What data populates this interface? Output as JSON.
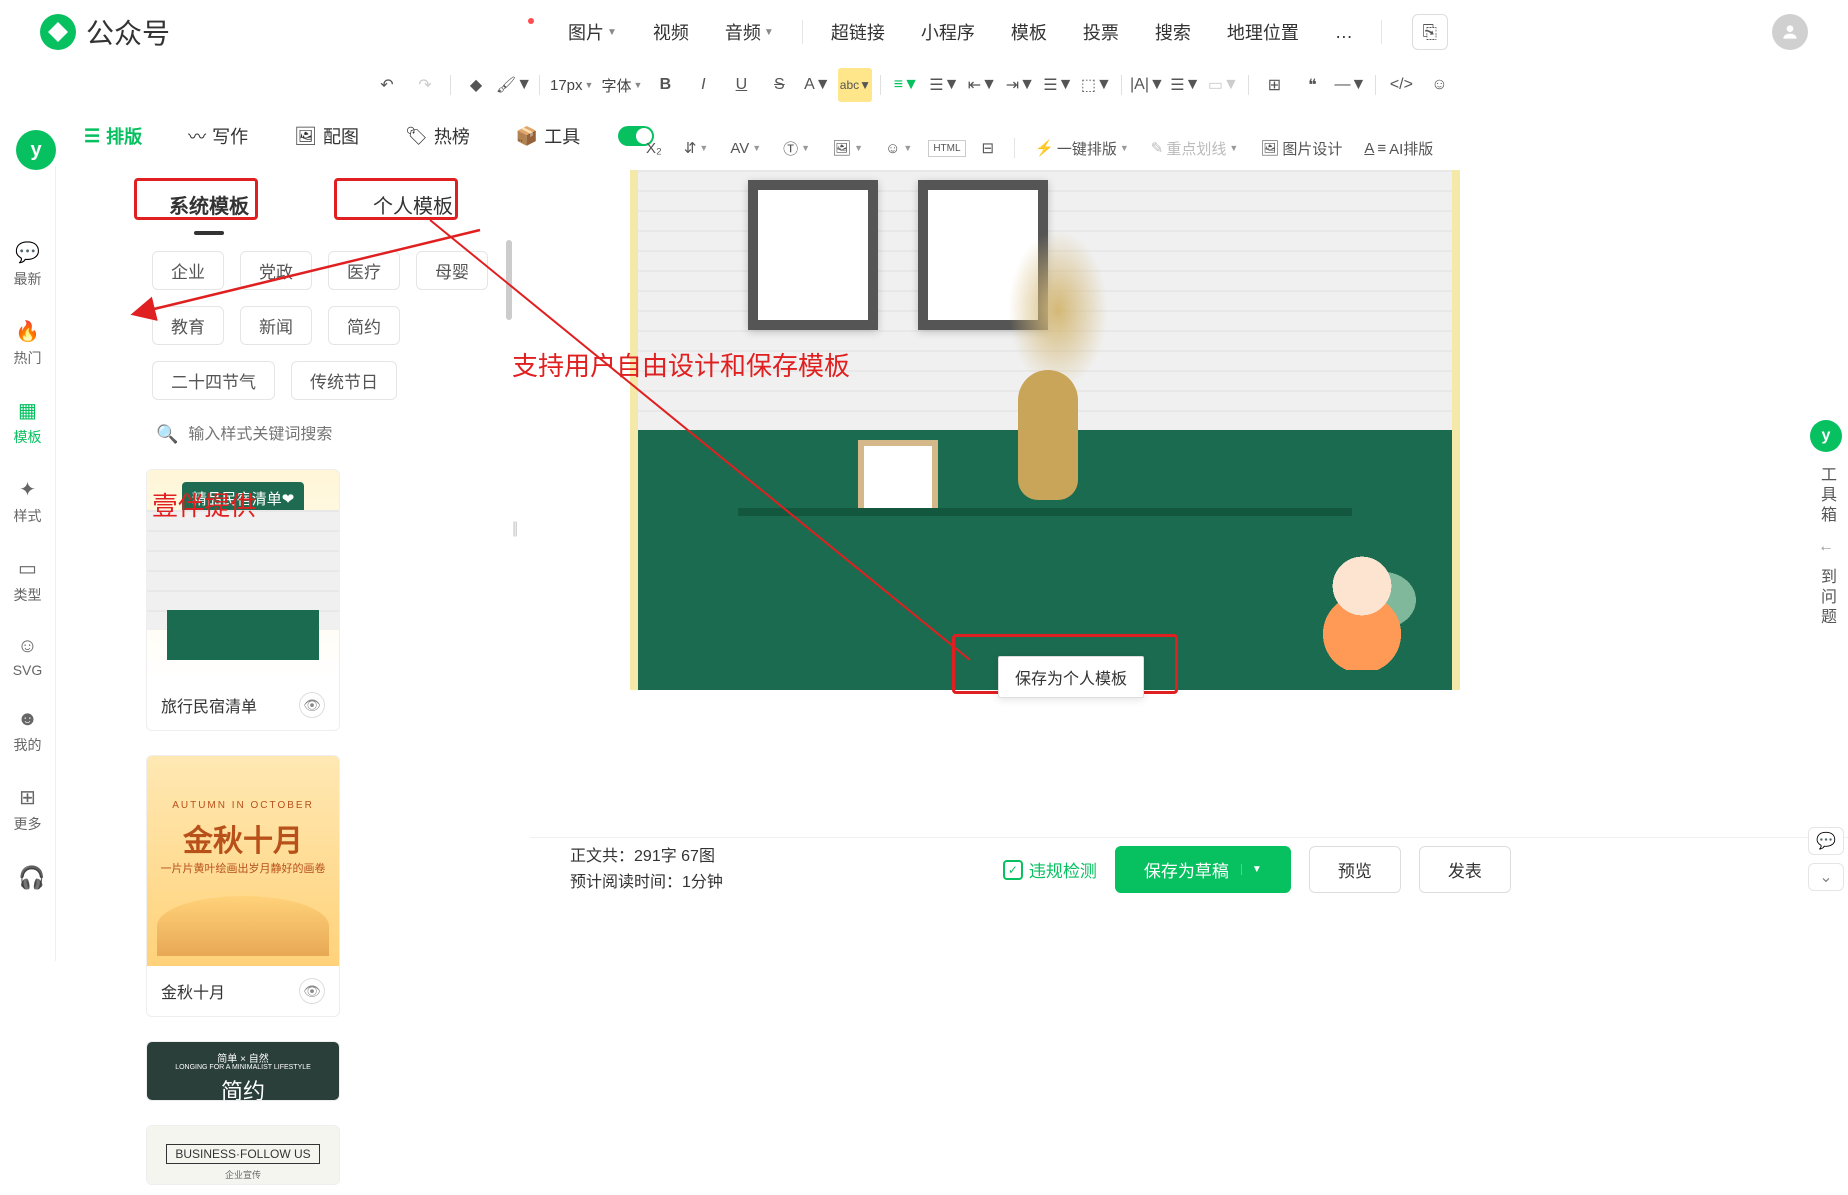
{
  "header": {
    "app_name": "公众号",
    "menu": {
      "image": "图片",
      "video": "视频",
      "audio": "音频",
      "link": "超链接",
      "miniprogram": "小程序",
      "template": "模板",
      "vote": "投票",
      "search": "搜索",
      "location": "地理位置",
      "more": "…"
    }
  },
  "toolbar1": {
    "font_size": "17px",
    "font_family": "字体"
  },
  "toolbar2": {
    "auto_layout": "一键排版",
    "highlight": "重点划线",
    "image_design": "图片设计",
    "ai_layout": "AI排版"
  },
  "tabs": {
    "layout": "排版",
    "write": "写作",
    "image": "配图",
    "hot": "热榜",
    "tools": "工具"
  },
  "left_rail": [
    {
      "icon": "💬",
      "label": "最新"
    },
    {
      "icon": "🔥",
      "label": "热门"
    },
    {
      "icon": "▦",
      "label": "模板",
      "active": true
    },
    {
      "icon": "✦",
      "label": "样式"
    },
    {
      "icon": "▭",
      "label": "类型"
    },
    {
      "icon": "☺",
      "label": "SVG"
    },
    {
      "icon": "☻",
      "label": "我的"
    },
    {
      "icon": "⊞",
      "label": "更多"
    }
  ],
  "template_tabs": {
    "system": "系统模板",
    "personal": "个人模板"
  },
  "categories": [
    "企业",
    "党政",
    "医疗",
    "母婴",
    "教育",
    "新闻",
    "简约",
    "二十四节气",
    "传统节日"
  ],
  "search": {
    "placeholder": "输入样式关键词搜索"
  },
  "annotations": {
    "provider": "壹伴提供",
    "support": "支持用户自由设计和保存模板"
  },
  "templates": [
    {
      "title": "旅行民宿清单",
      "banner": "精品民宿清单❤"
    },
    {
      "title": "金秋十月",
      "banner": "金秋十月",
      "sub": "AUTUMN IN OCTOBER",
      "desc": "一片片黄叶绘画出岁月静好的画卷"
    },
    {
      "title": "简约",
      "banner": "简单 × 自然",
      "sub": "LONGING FOR A MINIMALIST LIFESTYLE"
    },
    {
      "title": "",
      "banner": "BUSINESS·FOLLOW US",
      "sub": "企业宣传"
    }
  ],
  "tooltip": {
    "save_personal": "保存为个人模板"
  },
  "bottom": {
    "word_count_label": "正文共：",
    "word_count": "291字 67图",
    "read_time_label": "预计阅读时间：",
    "read_time": "1分钟",
    "detect": "违规检测",
    "save_draft": "保存为草稿",
    "preview": "预览",
    "publish": "发表"
  },
  "right_rail": {
    "toolbox": "工具箱",
    "faq": "到问题"
  }
}
